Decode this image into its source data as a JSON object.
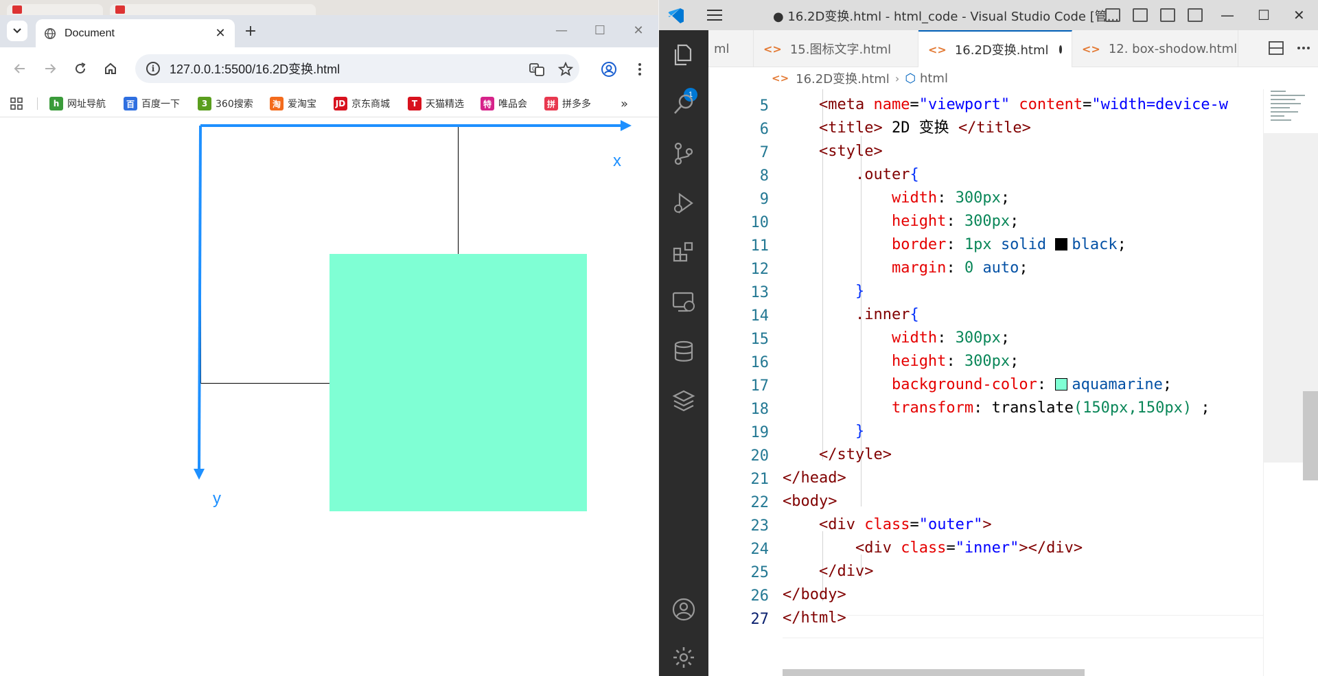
{
  "chrome": {
    "tab_title": "Document",
    "url": "127.0.0.1:5500/16.2D变换.html",
    "bookmarks": [
      "网址导航",
      "百度一下",
      "360搜索",
      "爱淘宝",
      "京东商城",
      "天猫精选",
      "唯品会",
      "拼多多"
    ],
    "bookmark_colors": [
      "#3a9b3a",
      "#2f6fe0",
      "#5a9e1e",
      "#f36b1c",
      "#d8121e",
      "#d8121e",
      "#d6238a",
      "#e8384f"
    ],
    "page": {
      "outer_border": "#000000",
      "inner_color": "#7fffd4",
      "axis_color": "#1e90ff",
      "x_label": "x",
      "y_label": "y"
    }
  },
  "vscode": {
    "window_title": "● 16.2D变换.html - html_code - Visual Studio Code [管...",
    "explorer_badge": "1",
    "tabs": [
      {
        "label": "ml",
        "active": false
      },
      {
        "label": "15.图标文字.html",
        "active": false
      },
      {
        "label": "16.2D变换.html",
        "active": true,
        "modified": true
      },
      {
        "label": "12. box-shodow.html",
        "active": false
      }
    ],
    "breadcrumb": [
      "16.2D变换.html",
      "html"
    ],
    "line_numbers": [
      "5",
      "6",
      "7",
      "8",
      "9",
      "10",
      "11",
      "12",
      "13",
      "14",
      "15",
      "16",
      "17",
      "18",
      "19",
      "20",
      "21",
      "22",
      "23",
      "24",
      "25",
      "26",
      "27"
    ],
    "current_line": "27"
  }
}
